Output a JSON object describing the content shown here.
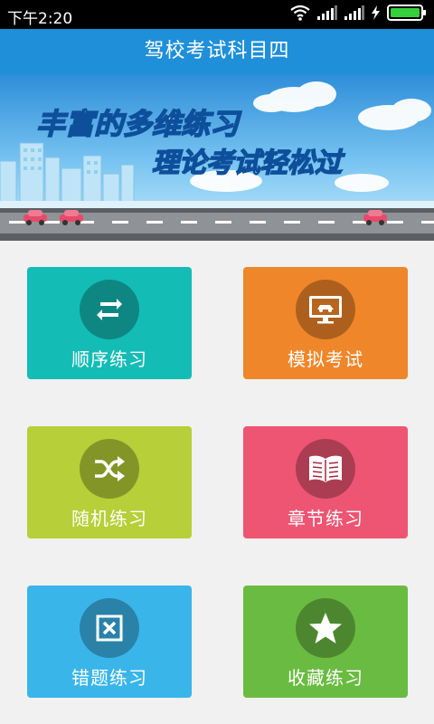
{
  "status_bar": {
    "time": "下午2:20",
    "icons": [
      "wifi-icon",
      "signal-icon",
      "signal-icon",
      "charging-icon",
      "battery-icon"
    ]
  },
  "header": {
    "title": "驾校考试科目四"
  },
  "banner": {
    "line1": "丰富的多维练习",
    "line2": "理论考试轻松过"
  },
  "tiles": [
    {
      "label": "顺序练习",
      "icon": "sequence-icon",
      "color": "#14bcb6"
    },
    {
      "label": "模拟考试",
      "icon": "exam-monitor-icon",
      "color": "#f0862a"
    },
    {
      "label": "随机练习",
      "icon": "shuffle-icon",
      "color": "#b7cf38"
    },
    {
      "label": "章节练习",
      "icon": "book-icon",
      "color": "#ee5573"
    },
    {
      "label": "错题练习",
      "icon": "wrong-box-icon",
      "color": "#3ab5ea"
    },
    {
      "label": "收藏练习",
      "icon": "star-icon",
      "color": "#6abb42"
    }
  ]
}
